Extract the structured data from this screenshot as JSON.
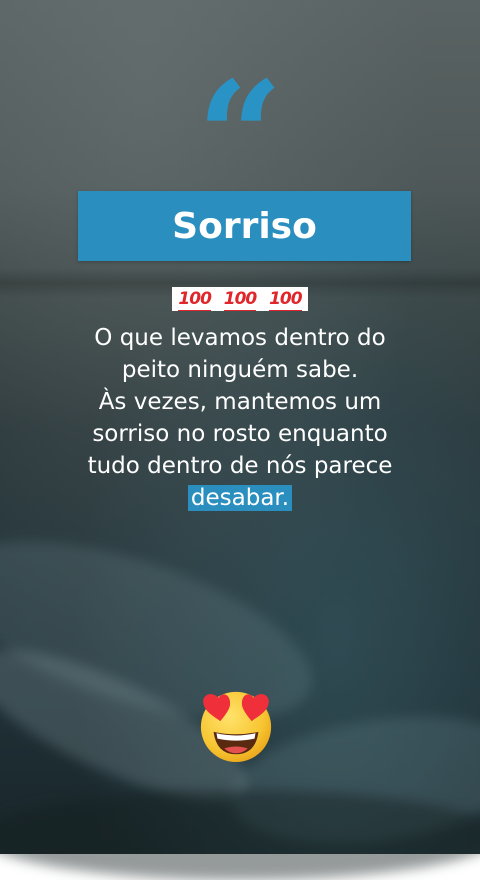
{
  "title": "Sorriso",
  "quote_mark": "“",
  "emoji_100": [
    "100",
    "100",
    "100"
  ],
  "text_lines": [
    "O que levamos dentro do",
    "peito ninguém sabe.",
    "Às vezes, mantemos um",
    "sorriso no rosto enquanto",
    "tudo dentro de nós parece"
  ],
  "highlight_word": "desabar.",
  "icons": {
    "bottom_emoji": "heart-eyes-smiling-face-icon",
    "top_emoji": "hundred-points-icon"
  },
  "colors": {
    "accent": "#2a8fbf",
    "text": "#ffffff",
    "emoji_red": "#e0262a"
  }
}
